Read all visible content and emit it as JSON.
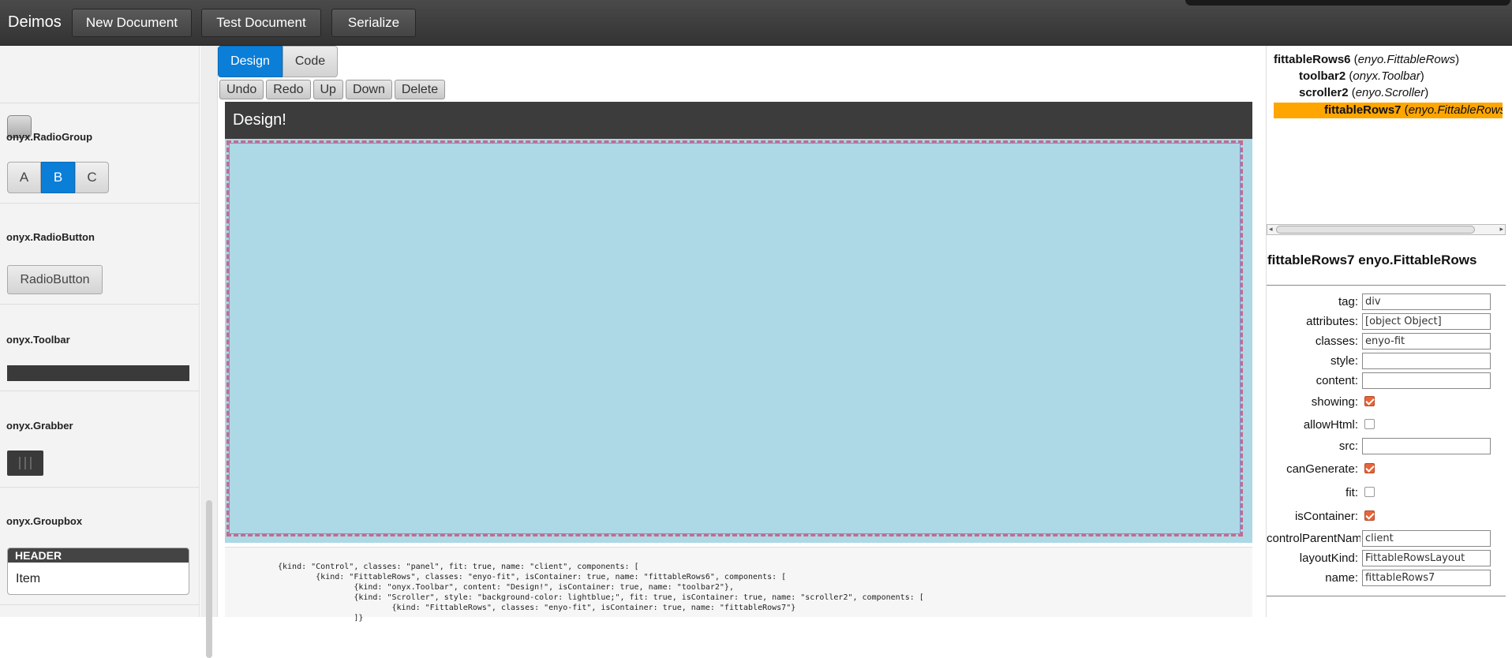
{
  "app": {
    "title": "Deimos",
    "toolbar": [
      "New Document",
      "Test Document",
      "Serialize"
    ]
  },
  "palette": {
    "items": [
      {
        "label": "onyx.RadioGroup"
      },
      {
        "label": "onyx.RadioButton"
      },
      {
        "label": "onyx.Toolbar"
      },
      {
        "label": "onyx.Grabber"
      },
      {
        "label": "onyx.Groupbox"
      }
    ],
    "radio_group": {
      "options": [
        "A",
        "B",
        "C"
      ],
      "selected": "B"
    },
    "radio_button_label": "RadioButton",
    "groupbox": {
      "header": "HEADER",
      "item": "Item"
    }
  },
  "editor": {
    "tabs": [
      {
        "label": "Design",
        "active": true
      },
      {
        "label": "Code",
        "active": false
      }
    ],
    "actions": [
      "Undo",
      "Redo",
      "Up",
      "Down",
      "Delete"
    ],
    "design_toolbar_content": "Design!",
    "design_background": "#add8e6",
    "code_lines": [
      "{kind: \"Control\", classes: \"panel\", fit: true, name: \"client\", components: [",
      "        {kind: \"FittableRows\", classes: \"enyo-fit\", isContainer: true, name: \"fittableRows6\", components: [",
      "                {kind: \"onyx.Toolbar\", content: \"Design!\", isContainer: true, name: \"toolbar2\"},",
      "                {kind: \"Scroller\", style: \"background-color: lightblue;\", fit: true, isContainer: true, name: \"scroller2\", components: [",
      "                        {kind: \"FittableRows\", classes: \"enyo-fit\", isContainer: true, name: \"fittableRows7\"}",
      "                ]}"
    ]
  },
  "inspector": {
    "tree": [
      {
        "name": "fittableRows6",
        "kind": "enyo.FittableRows",
        "selected": false
      },
      {
        "name": "toolbar2",
        "kind": "onyx.Toolbar",
        "selected": false
      },
      {
        "name": "scroller2",
        "kind": "enyo.Scroller",
        "selected": false
      },
      {
        "name": "fittableRows7",
        "kind": "enyo.FittableRows",
        "selected": true
      }
    ],
    "selection_color": "#ffa500",
    "title": "fittableRows7 enyo.FittableRows",
    "properties": [
      {
        "label": "tag:",
        "type": "text",
        "value": "div"
      },
      {
        "label": "attributes:",
        "type": "text",
        "value": "[object Object]"
      },
      {
        "label": "classes:",
        "type": "text",
        "value": "enyo-fit"
      },
      {
        "label": "style:",
        "type": "text",
        "value": ""
      },
      {
        "label": "content:",
        "type": "text",
        "value": ""
      },
      {
        "label": "showing:",
        "type": "checkbox",
        "checked": true
      },
      {
        "label": "allowHtml:",
        "type": "checkbox",
        "checked": false
      },
      {
        "label": "src:",
        "type": "text",
        "value": ""
      },
      {
        "label": "canGenerate:",
        "type": "checkbox",
        "checked": true
      },
      {
        "label": "fit:",
        "type": "checkbox",
        "checked": false
      },
      {
        "label": "isContainer:",
        "type": "checkbox",
        "checked": true
      },
      {
        "label": "controlParentName:",
        "type": "text",
        "value": "client"
      },
      {
        "label": "layoutKind:",
        "type": "text",
        "value": "FittableRowsLayout"
      },
      {
        "label": "name:",
        "type": "text",
        "value": "fittableRows7"
      }
    ],
    "check_color": "#e8643a"
  }
}
